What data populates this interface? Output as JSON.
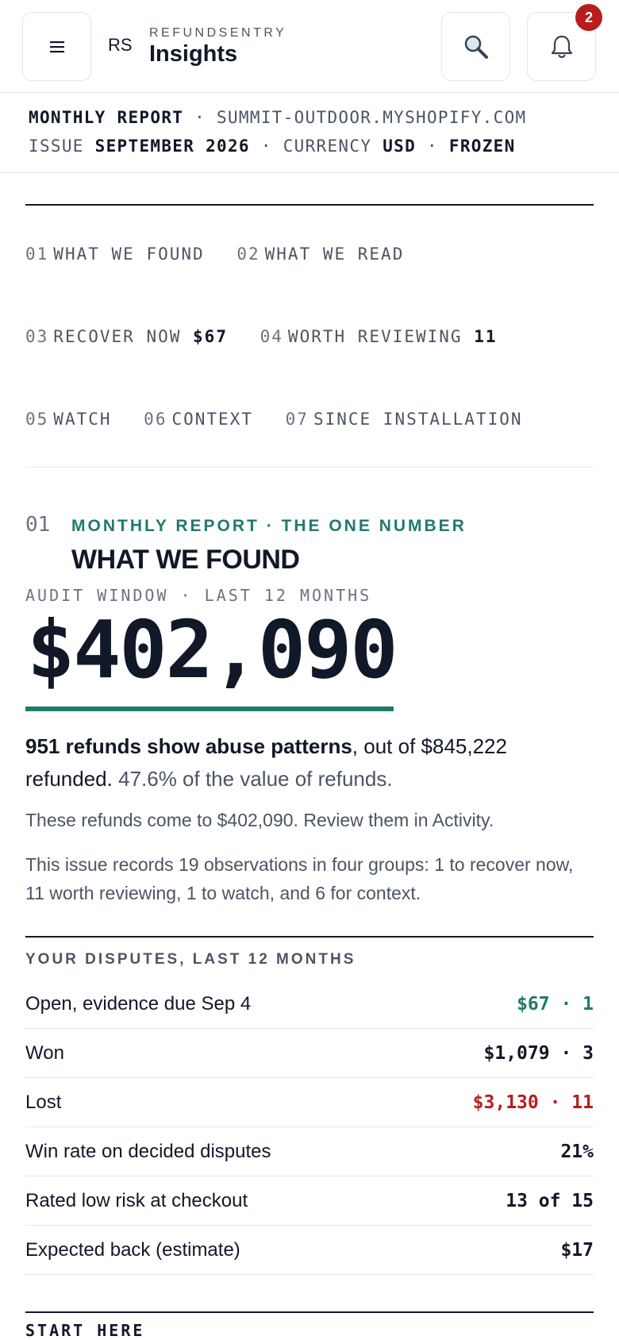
{
  "header": {
    "menu_icon": "hamburger-icon",
    "brand_mark": "RS",
    "brand_name": "REFUNDSENTRY",
    "title": "Insights",
    "search_icon": "magnifier-icon",
    "bell_icon": "bell-icon",
    "notification_count": "2"
  },
  "report_bar": {
    "line1_label": "MONTHLY REPORT",
    "line1_sep": " · ",
    "store": "SUMMIT-OUTDOOR.MYSHOPIFY.COM",
    "issue_label": "ISSUE",
    "issue_value": "SEPTEMBER 2026",
    "sep": " · ",
    "currency_label": "CURRENCY",
    "currency_value": "USD",
    "status": "FROZEN"
  },
  "toc": [
    {
      "num": "01",
      "label": "WHAT WE FOUND",
      "value": ""
    },
    {
      "num": "02",
      "label": "WHAT WE READ",
      "value": ""
    },
    {
      "num": "03",
      "label": "RECOVER NOW",
      "value": "$67"
    },
    {
      "num": "04",
      "label": "WORTH REVIEWING",
      "value": "11"
    },
    {
      "num": "05",
      "label": "WATCH",
      "value": ""
    },
    {
      "num": "06",
      "label": "CONTEXT",
      "value": ""
    },
    {
      "num": "07",
      "label": "SINCE INSTALLATION",
      "value": ""
    }
  ],
  "section01": {
    "num": "01",
    "kicker": "MONTHLY REPORT · THE ONE NUMBER",
    "title": "WHAT WE FOUND",
    "audit_label": "AUDIT WINDOW · LAST 12 MONTHS",
    "big_number": "$402,090",
    "lead_bold": "951 refunds show abuse patterns",
    "lead_rest": ", out of $845,222 refunded.",
    "lead_soft": "47.6% of the value of refunds.",
    "para1": "These refunds come to $402,090. Review them in Activity.",
    "para2": "This issue records 19 observations in four groups: 1 to recover now, 11 worth reviewing, 1 to watch, and 6 for context."
  },
  "disputes": {
    "title": "YOUR DISPUTES, LAST 12 MONTHS",
    "rows": [
      {
        "label": "Open, evidence due Sep 4",
        "value": "$67 · 1",
        "tone": "teal"
      },
      {
        "label": "Won",
        "value": "$1,079 · 3",
        "tone": "dark"
      },
      {
        "label": "Lost",
        "value": "$3,130 · 11",
        "tone": "red"
      },
      {
        "label": "Win rate on decided disputes",
        "value": "21%",
        "tone": "dark"
      },
      {
        "label": "Rated low risk at checkout",
        "value": "13 of 15",
        "tone": "dark"
      },
      {
        "label": "Expected back (estimate)",
        "value": "$17",
        "tone": "dark"
      }
    ]
  },
  "start_here": "START HERE",
  "colors": {
    "accent": "#1f7a6d",
    "danger": "#b91c1c",
    "text": "#111827",
    "muted": "#4b5563"
  }
}
